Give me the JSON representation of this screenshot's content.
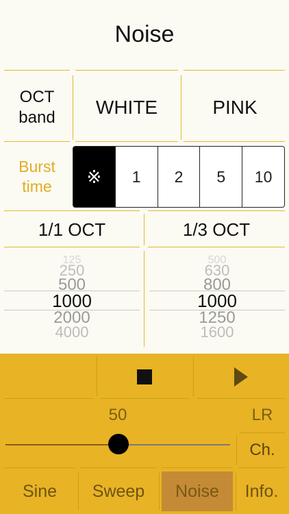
{
  "title": "Noise",
  "oct_band": {
    "line1": "OCT",
    "line2": "band"
  },
  "noise_types": {
    "white": "WHITE",
    "pink": "PINK"
  },
  "burst": {
    "label_line1": "Burst",
    "label_line2": "time",
    "options": [
      "※",
      "1",
      "2",
      "5",
      "10"
    ],
    "selected_index": 0
  },
  "oct_tabs": {
    "full": "1/1 OCT",
    "third": "1/3 OCT"
  },
  "picker_left": {
    "items": [
      "125",
      "250",
      "500",
      "1000",
      "2000",
      "4000"
    ],
    "selected": "1000"
  },
  "picker_right": {
    "items": [
      "500",
      "630",
      "800",
      "1000",
      "1250",
      "1600"
    ],
    "selected": "1000"
  },
  "playback": {
    "stop_icon": "stop-icon",
    "play_icon": "play-icon"
  },
  "volume": {
    "value": "50",
    "level_fraction": 0.5
  },
  "channel": {
    "value": "LR",
    "button_label": "Ch."
  },
  "tabs": {
    "sine": "Sine",
    "sweep": "Sweep",
    "noise": "Noise",
    "info": "Info."
  },
  "colors": {
    "accent": "#e8b324",
    "burst_label": "#e0ae25",
    "selected_tab": "#c48a35"
  }
}
